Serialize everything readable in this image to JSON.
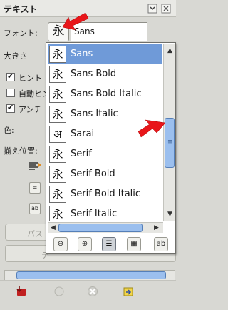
{
  "panel": {
    "title": "テキスト",
    "font_label": "フォント:",
    "font_value": "Sans",
    "font_preview_glyph": "永",
    "size_label": "大きさ",
    "hinting_label": "ヒント",
    "autohint_label": "自動ヒン",
    "antialias_label": "アンチ",
    "color_label": "色:",
    "justify_label": "揃え位置:",
    "path_button_label": "パス",
    "text_button_label": "テ"
  },
  "checkboxes": {
    "hinting_checked": true,
    "autohint_checked": false,
    "antialias_checked": true
  },
  "font_popup": {
    "selected_index": 0,
    "items": [
      {
        "glyph": "永",
        "name": "Sans"
      },
      {
        "glyph": "永",
        "name": "Sans Bold"
      },
      {
        "glyph": "永",
        "name": "Sans Bold Italic"
      },
      {
        "glyph": "永",
        "name": "Sans Italic"
      },
      {
        "glyph": "अ",
        "name": "Sarai"
      },
      {
        "glyph": "永",
        "name": "Serif"
      },
      {
        "glyph": "永",
        "name": "Serif Bold"
      },
      {
        "glyph": "永",
        "name": "Serif Bold Italic"
      },
      {
        "glyph": "永",
        "name": "Serif Italic"
      }
    ],
    "footer_buttons": [
      "zoom-out",
      "zoom-in",
      "list-view",
      "grid-view",
      "text-preview"
    ]
  },
  "colors": {
    "selection": "#6f9ad8",
    "scroll_thumb": "#9bbfee",
    "annotation_arrow": "#e8161a"
  }
}
